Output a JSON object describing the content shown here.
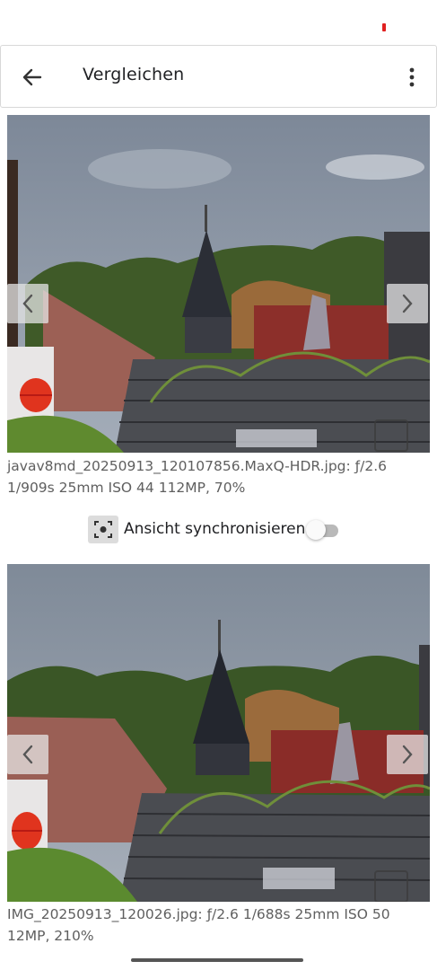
{
  "app_bar": {
    "title": "Vergleichen"
  },
  "images": {
    "top": {
      "caption": "javav8md_20250913_120107856.MaxQ-HDR.jpg: ƒ/2.6 1/909s 25mm ISO 44 112MP, 70%"
    },
    "bottom": {
      "caption": "IMG_20250913_120026.jpg: ƒ/2.6 1/688s 25mm ISO 50 12MP, 210%"
    }
  },
  "sync": {
    "label": "Ansicht synchronisieren",
    "enabled": false
  },
  "colors": {
    "status_indicator": "#e02020",
    "sky": "#8a96a6",
    "roof_red": "#9a3a32",
    "foliage": "#4d6b2a",
    "lantern": "#e0341e"
  },
  "icons": [
    "back-arrow-icon",
    "more-vert-icon",
    "chevron-left-icon",
    "chevron-right-icon",
    "sync-view-icon",
    "zoom-icon"
  ]
}
